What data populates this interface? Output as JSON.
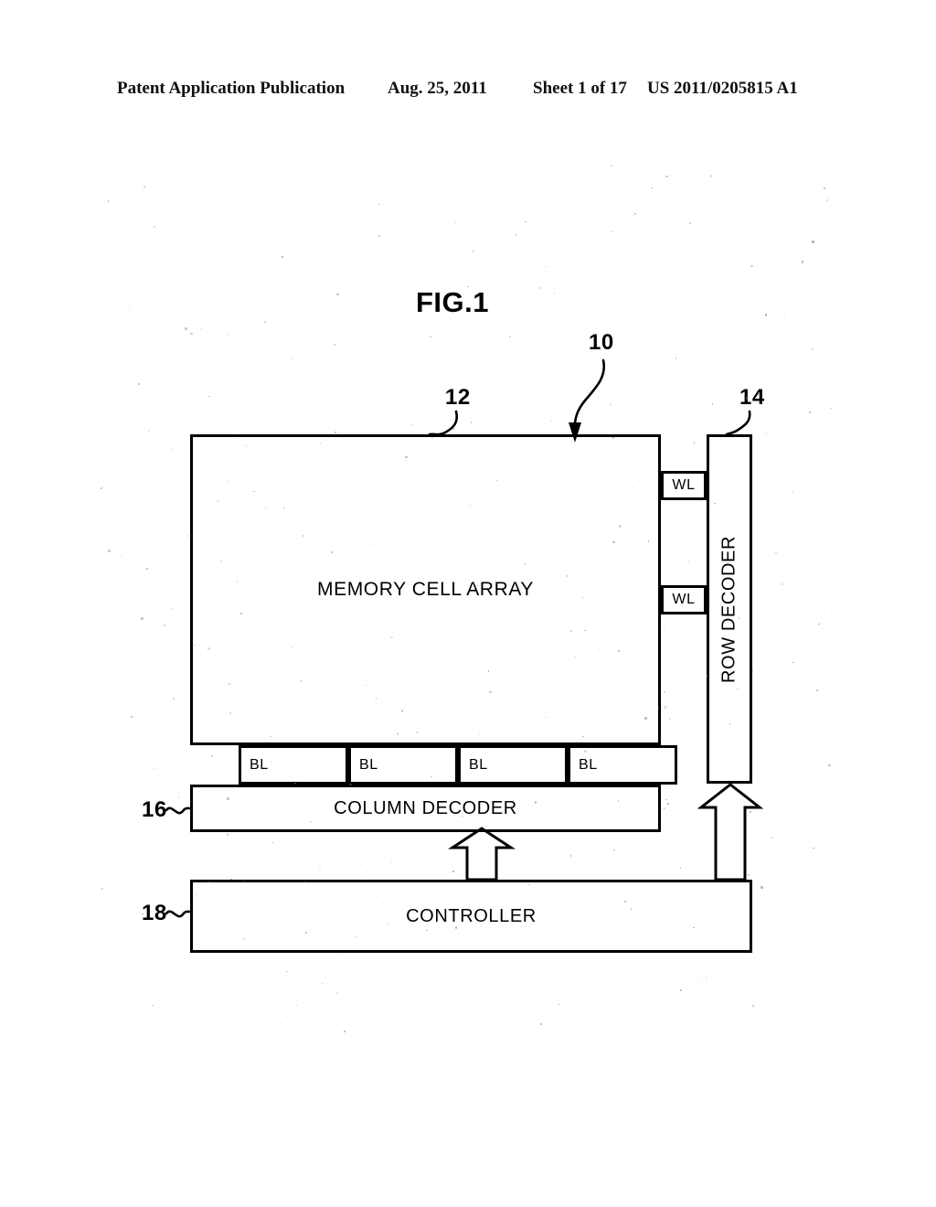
{
  "header": {
    "publication": "Patent Application Publication",
    "date": "Aug. 25, 2011",
    "sheet": "Sheet 1 of 17",
    "document_number": "US 2011/0205815 A1"
  },
  "figure": {
    "title": "FIG.1",
    "blocks": {
      "memory_array": "MEMORY CELL ARRAY",
      "row_decoder": "ROW DECODER",
      "column_decoder": "COLUMN DECODER",
      "controller": "CONTROLLER"
    },
    "word_lines": [
      {
        "label": "WL"
      },
      {
        "label": "WL"
      }
    ],
    "bit_lines": [
      {
        "label": "BL"
      },
      {
        "label": "BL"
      },
      {
        "label": "BL"
      },
      {
        "label": "BL"
      }
    ],
    "reference_numerals": [
      {
        "id": "10",
        "label": "10",
        "points_to": "overall-device"
      },
      {
        "id": "12",
        "label": "12",
        "points_to": "memory-cell-array"
      },
      {
        "id": "14",
        "label": "14",
        "points_to": "row-decoder"
      },
      {
        "id": "16",
        "label": "16",
        "points_to": "column-decoder"
      },
      {
        "id": "18",
        "label": "18",
        "points_to": "controller"
      }
    ],
    "colors": {
      "line": "#000000",
      "background": "#ffffff"
    }
  }
}
